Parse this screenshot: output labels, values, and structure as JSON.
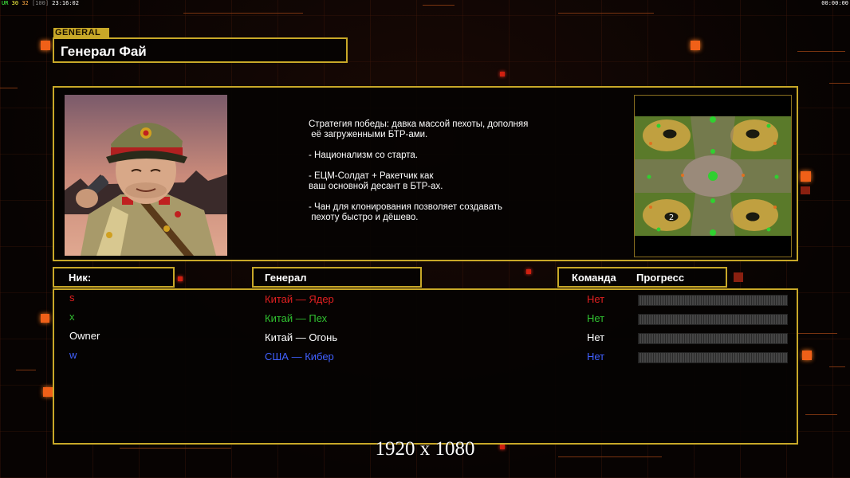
{
  "hud": {
    "ur_label": "UR",
    "fps_a": "30",
    "fps_b": "32",
    "bracket": "[100]",
    "clock": "23:16:02",
    "timer": "00:00:00"
  },
  "general_tag": "GENERAL",
  "title": "Генерал Фай",
  "description": "Стратегия победы: давка массой пехоты, дополняя\n её загруженными БТР-ами.\n\n- Национализм со старта.\n\n- ЕЦМ-Солдат + Ракетчик как\nваш основной десант в БТР-ах.\n\n- Чан для клонирования позволяет создавать\n пехоту быстро и дёшево.",
  "headers": {
    "nick": "Ник:",
    "general": "Генерал",
    "team": "Команда",
    "progress": "Прогресс"
  },
  "players": [
    {
      "nick": "s",
      "general": "Китай — Ядер",
      "team": "Нет",
      "color": "#e02020"
    },
    {
      "nick": "x",
      "general": "Китай — Пех",
      "team": "Нет",
      "color": "#30c030"
    },
    {
      "nick": "Owner",
      "general": "Китай — Огонь",
      "team": "Нет",
      "color": "#ffffff"
    },
    {
      "nick": "w",
      "general": "США — Кибер",
      "team": "Нет",
      "color": "#4060ff"
    }
  ],
  "minimap": {
    "player_slot": "2"
  },
  "resolution": "1920 x 1080",
  "colors": {
    "frame": "#c8a828",
    "accent": "#f06018"
  }
}
